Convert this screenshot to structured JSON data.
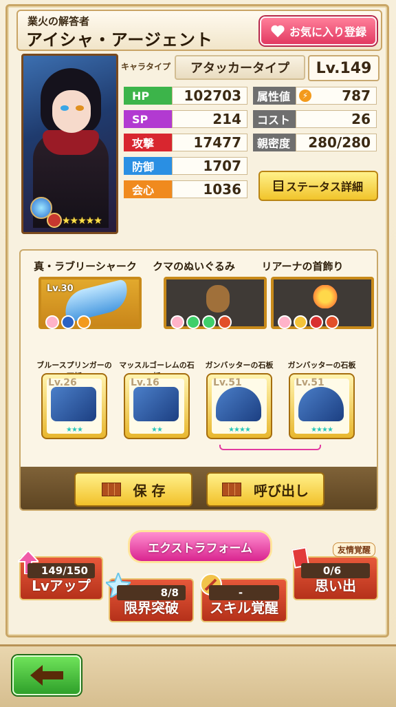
{
  "header": {
    "subtitle": "業火の解答者",
    "name": "アイシャ・アージェント",
    "favorite_label": "お気に入り登録"
  },
  "character": {
    "type_label": "キャラタイプ",
    "type_value": "アタッカータイプ",
    "level": "Lv.149",
    "rarity_stars": "★★★★★"
  },
  "stats_left": [
    {
      "label": "HP",
      "value": "102703",
      "color": "#3cb44a"
    },
    {
      "label": "SP",
      "value": "214",
      "color": "#b23ad1"
    },
    {
      "label": "攻撃",
      "value": "17477",
      "color": "#d8262f"
    },
    {
      "label": "防御",
      "value": "1707",
      "color": "#2a8fe3"
    },
    {
      "label": "会心",
      "value": "1036",
      "color": "#f08a1e"
    }
  ],
  "stats_right": [
    {
      "label": "属性値",
      "value": "787",
      "color": "#6f6f6f"
    },
    {
      "label": "コスト",
      "value": "26",
      "color": "#6f6f6f"
    },
    {
      "label": "親密度",
      "value": "280/280",
      "color": "#6f6f6f"
    }
  ],
  "status_detail_label": "ステータス詳細",
  "equipment": [
    {
      "name": "真・ラブリーシャーク",
      "level": "Lv.30"
    },
    {
      "name": "クマのぬいぐるみ",
      "level": ""
    },
    {
      "name": "リアーナの首飾り",
      "level": ""
    }
  ],
  "slates": [
    {
      "name": "ブルースプリンガーの石板",
      "level": "Lv.26",
      "stars": "★★★"
    },
    {
      "name": "マッスルゴーレムの石板",
      "level": "Lv.16",
      "stars": "★★"
    },
    {
      "name": "ガンバッターの石板",
      "level": "Lv.51",
      "stars": "★★★★"
    },
    {
      "name": "ガンバッターの石板",
      "level": "Lv.51",
      "stars": "★★★★"
    }
  ],
  "save_label": "保 存",
  "load_label": "呼び出し",
  "extra_form_label": "エクストラフォーム",
  "lv_up": {
    "count": "149/150",
    "label": "Lvアップ"
  },
  "limit_break": {
    "count": "8/8",
    "label": "限界突破"
  },
  "skill_awaken": {
    "count": "-",
    "label": "スキル覚醒"
  },
  "memories": {
    "tag": "友情覚醒",
    "count": "0/6",
    "label": "思い出"
  }
}
